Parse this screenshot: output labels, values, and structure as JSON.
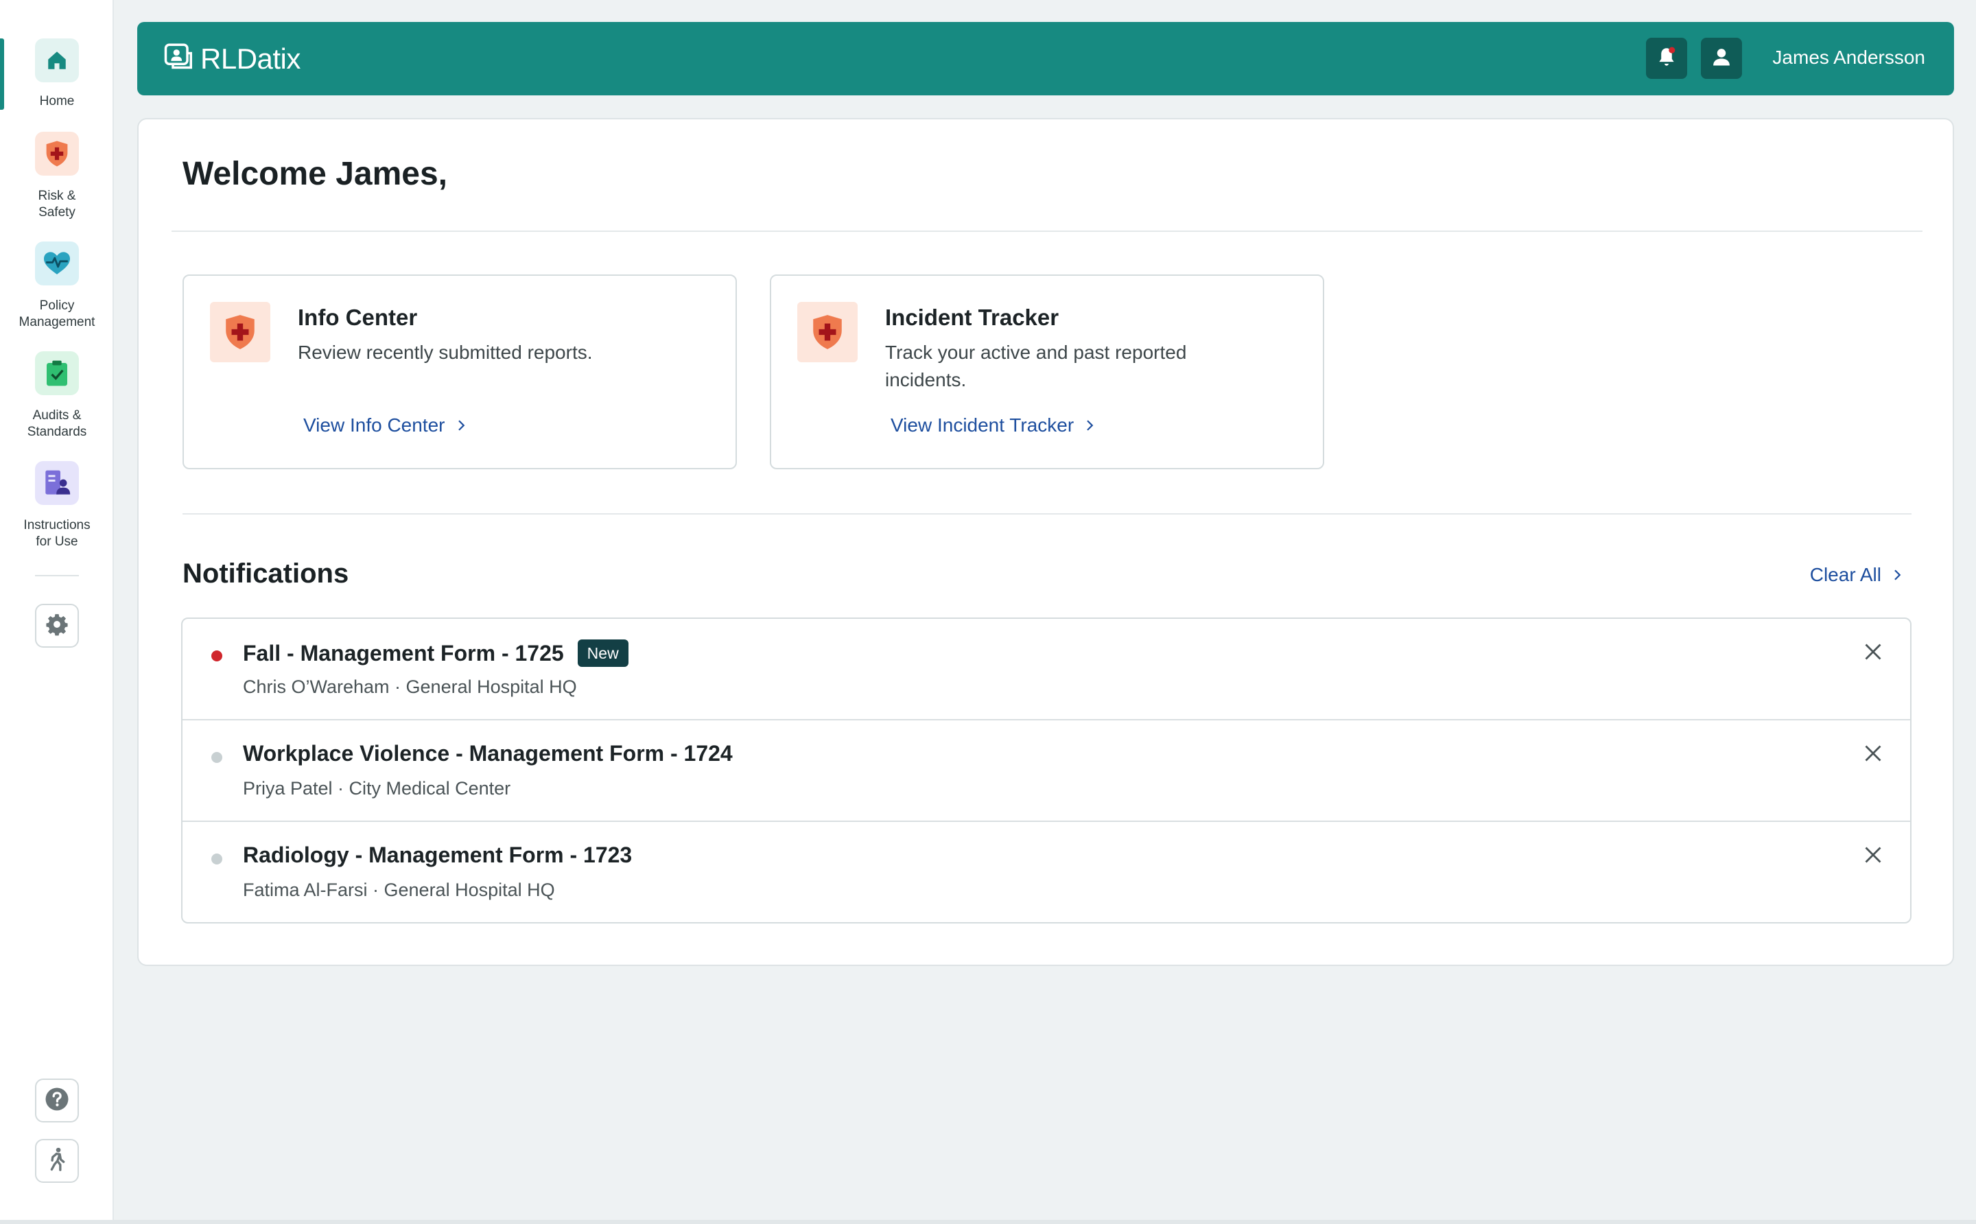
{
  "sidebar": {
    "items": [
      {
        "label": "Home",
        "icon": "home-icon",
        "active": true,
        "bg": "#e3f3f1",
        "color": "#178a81"
      },
      {
        "label": "Risk &\nSafety",
        "icon": "shield-cross-icon",
        "active": false,
        "bg": "#fde6dc",
        "color": "#e8613a"
      },
      {
        "label": "Policy\nManagement",
        "icon": "heart-pulse-icon",
        "active": false,
        "bg": "#d9f1f6",
        "color": "#2aa3c0"
      },
      {
        "label": "Audits &\nStandards",
        "icon": "clipboard-check-icon",
        "active": false,
        "bg": "#dcf5e6",
        "color": "#2fbf71"
      },
      {
        "label": "Instructions\nfor Use",
        "icon": "document-user-icon",
        "active": false,
        "bg": "#e6e4fb",
        "color": "#6456c8"
      }
    ],
    "settings_icon": "gear-icon",
    "help_icon": "help-icon",
    "walk_icon": "walking-person-icon"
  },
  "header": {
    "brand": "RLDatix",
    "brand_icon": "rldatix-logo-icon",
    "bell_icon": "bell-icon",
    "user_icon": "user-icon",
    "user_name": "James Andersson",
    "bg_color": "#178a81"
  },
  "main": {
    "welcome": "Welcome James,",
    "cards": [
      {
        "title": "Info Center",
        "description": "Review recently submitted reports.",
        "link": "View Info Center",
        "icon": "shield-cross-icon"
      },
      {
        "title": "Incident Tracker",
        "description": "Track your active and past reported incidents.",
        "link": "View Incident Tracker",
        "icon": "shield-cross-icon"
      }
    ],
    "notifications_title": "Notifications",
    "clear_all": "Clear All",
    "notifications": [
      {
        "title": "Fall - Management Form - 1725",
        "badge": "New",
        "subtitle": "Chris O’Wareham · General Hospital HQ",
        "unread": true
      },
      {
        "title": "Workplace Violence - Management Form - 1724",
        "badge": "",
        "subtitle": "Priya Patel · City Medical Center",
        "unread": false
      },
      {
        "title": "Radiology - Management Form - 1723",
        "badge": "",
        "subtitle": "Fatima Al-Farsi · General Hospital HQ",
        "unread": false
      }
    ]
  },
  "colors": {
    "accent": "#178a81",
    "link": "#1d4e9e",
    "unread_dot": "#d0262c",
    "read_dot": "#c8d0d2",
    "badge": "#133f45"
  }
}
